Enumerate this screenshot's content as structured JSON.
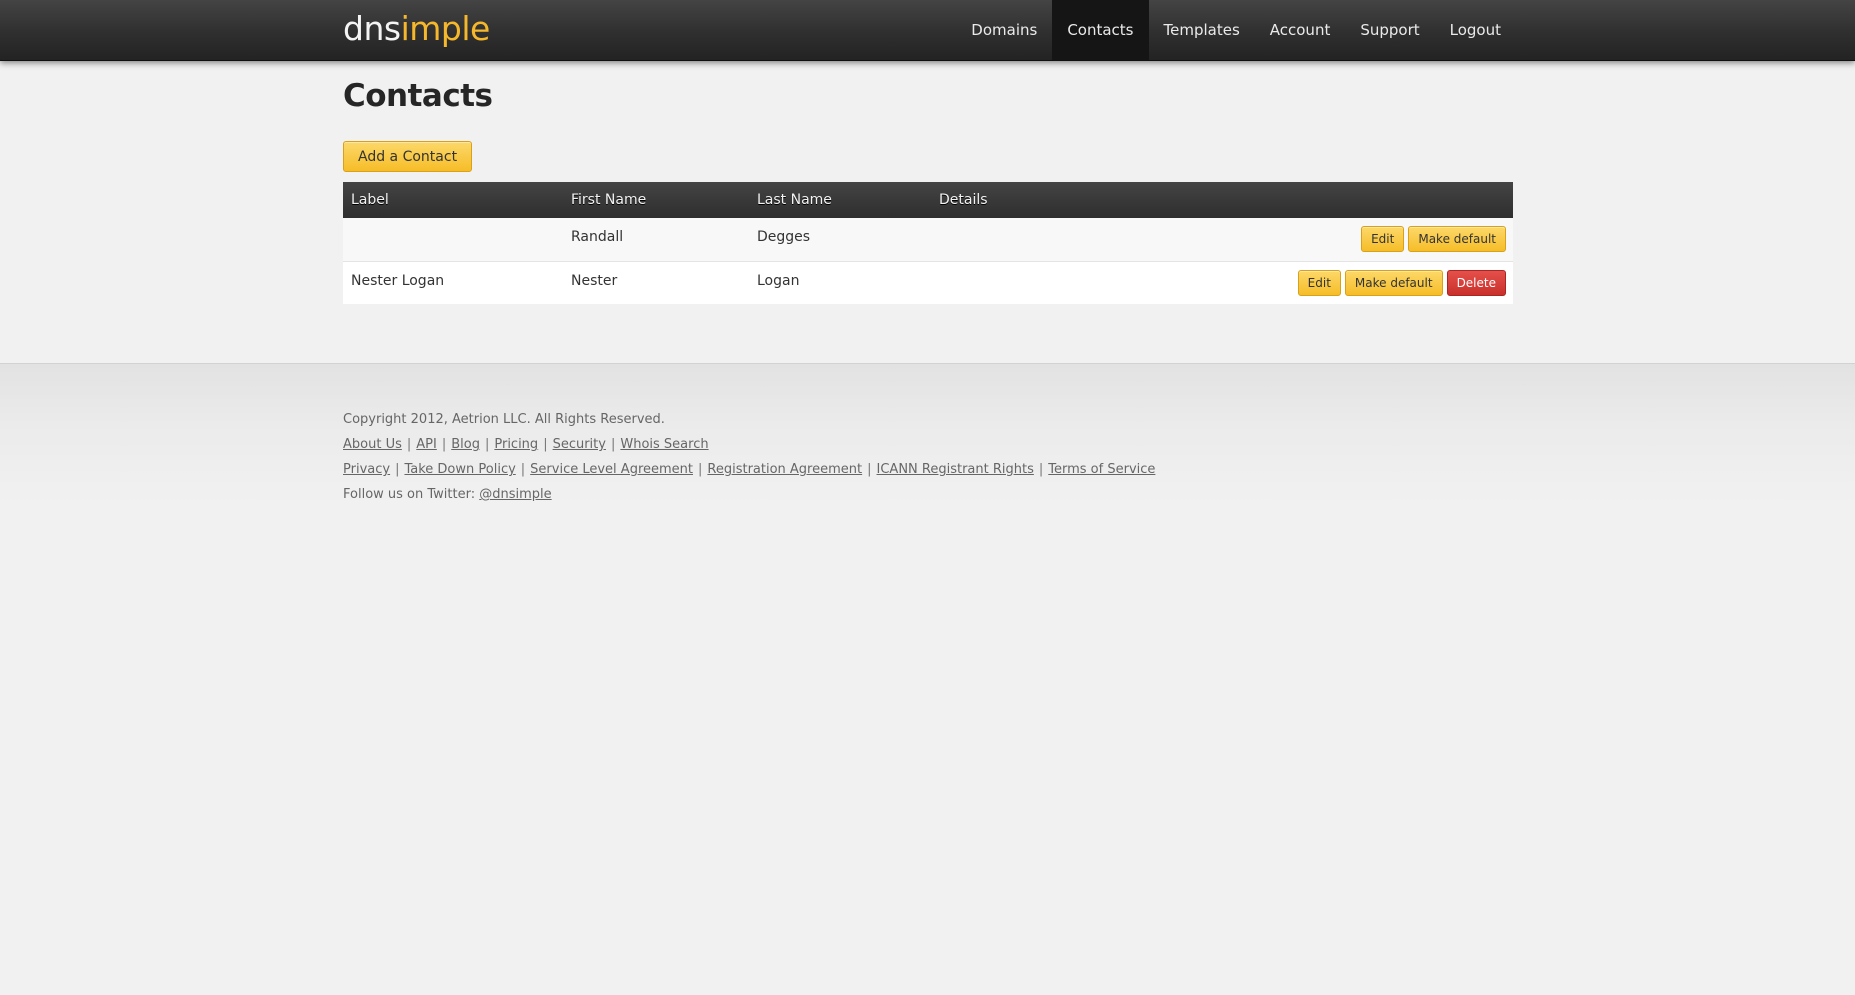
{
  "brand": {
    "logo_part1": "dns",
    "logo_part2": "imple"
  },
  "nav": [
    {
      "label": "Domains",
      "active": false
    },
    {
      "label": "Contacts",
      "active": true
    },
    {
      "label": "Templates",
      "active": false
    },
    {
      "label": "Account",
      "active": false
    },
    {
      "label": "Support",
      "active": false
    },
    {
      "label": "Logout",
      "active": false
    }
  ],
  "page": {
    "title": "Contacts",
    "add_button": "Add a Contact"
  },
  "table": {
    "headers": [
      "Label",
      "First Name",
      "Last Name",
      "Details"
    ],
    "rows": [
      {
        "label": "",
        "first_name": "Randall",
        "last_name": "Degges",
        "details": "",
        "edit": "Edit",
        "make_default": "Make default"
      },
      {
        "label": "Nester Logan",
        "first_name": "Nester",
        "last_name": "Logan",
        "details": "",
        "edit": "Edit",
        "make_default": "Make default",
        "delete": "Delete"
      }
    ]
  },
  "footer": {
    "copyright": "Copyright 2012, Aetrion LLC. All Rights Reserved.",
    "links1": [
      "About Us",
      "API",
      "Blog",
      "Pricing",
      "Security",
      "Whois Search"
    ],
    "links2": [
      "Privacy",
      "Take Down Policy",
      "Service Level Agreement",
      "Registration Agreement",
      "ICANN Registrant Rights",
      "Terms of Service"
    ],
    "twitter_prefix": "Follow us on Twitter: ",
    "twitter_handle": "@dnsimple",
    "separator": "|"
  },
  "colors": {
    "accent": "#f5b72b",
    "danger": "#d43f3a",
    "topbar": "#2f2f2f"
  }
}
